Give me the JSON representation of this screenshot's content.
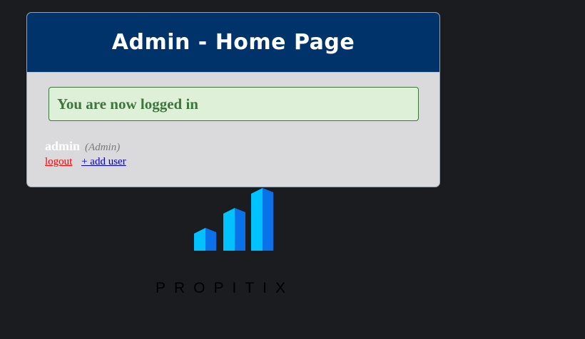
{
  "card": {
    "title": "Admin - Home Page",
    "alert_message": "You are now logged in",
    "user": {
      "name": "admin",
      "role": "(Admin)"
    },
    "links": {
      "logout": "logout",
      "add_user": "+ add user"
    }
  },
  "logo": {
    "brand_name": "PROPITIX",
    "icon": "bar-chart-logo-icon",
    "colors": {
      "light_blue": "#00c2ff",
      "dark_blue": "#0a72e8"
    }
  },
  "colors": {
    "header_bg": "#00336a",
    "card_bg": "#dad9db",
    "alert_bg": "#dff0d8",
    "alert_text": "#3c763d",
    "page_bg": "#1b1c20",
    "logout_link": "#ff0000",
    "add_user_link": "#0000cc"
  }
}
